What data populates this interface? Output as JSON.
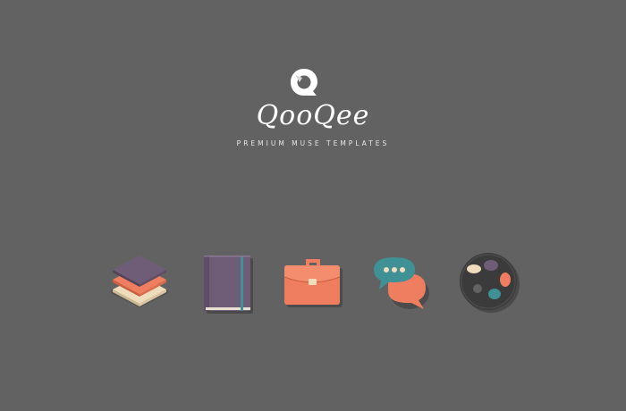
{
  "brand": {
    "name": "QooQee",
    "tagline": "PREMIUM MUSE TEMPLATES",
    "logo_icon": "qooqee-logo-mark"
  },
  "colors": {
    "background": "#626262",
    "purple": "#6f5d78",
    "coral": "#ef7d5f",
    "cream": "#efdcbd",
    "teal": "#3f9196",
    "dark": "#3b3b3b"
  },
  "icons": [
    {
      "name": "layers-icon"
    },
    {
      "name": "notebook-icon"
    },
    {
      "name": "briefcase-icon"
    },
    {
      "name": "chat-bubbles-icon"
    },
    {
      "name": "palette-icon"
    }
  ]
}
